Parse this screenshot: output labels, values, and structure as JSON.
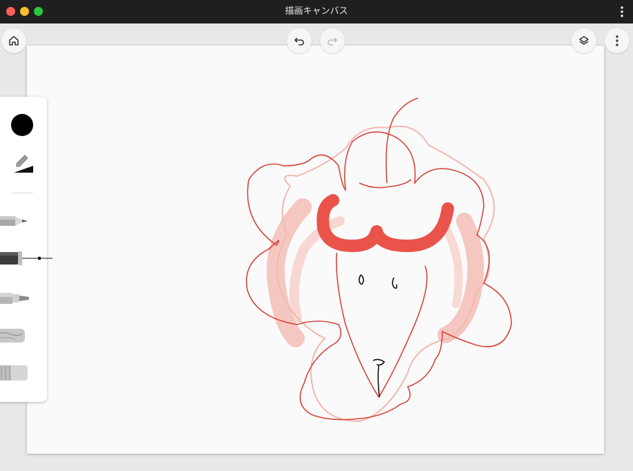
{
  "window": {
    "title": "描画キャンバス"
  },
  "colors": {
    "titlebar": "#1f1f1f",
    "canvas": "#fafafa",
    "stroke_red": "#d9463a",
    "stroke_pink": "#f2b3ab",
    "marker_red": "#ea534a",
    "selected_color": "#000000"
  },
  "top_controls": {
    "home": "home-icon",
    "undo": "undo-icon",
    "redo": "redo-icon",
    "layers": "layers-icon",
    "more": "more-vertical-icon"
  },
  "toolbar": {
    "selected_color": "#000000",
    "tools": [
      "pencil-icon",
      "fountain-pen-icon",
      "marker-icon",
      "chalk-icon",
      "eraser-icon"
    ],
    "selected_tool": "fountain-pen-icon"
  }
}
